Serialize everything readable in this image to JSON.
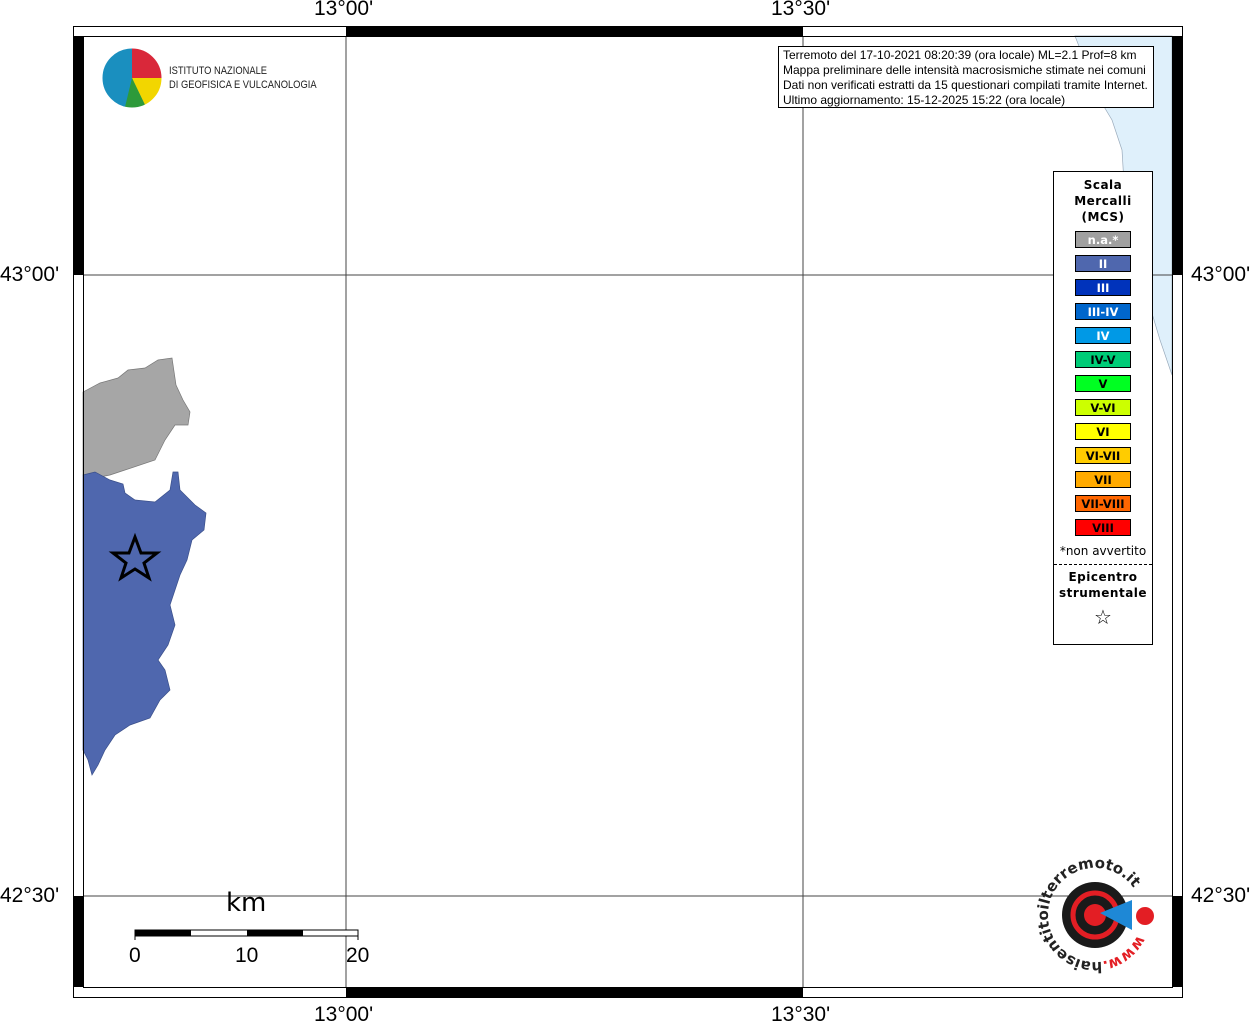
{
  "axes": {
    "lon_ticks": [
      "13°00'",
      "13°30'"
    ],
    "lat_ticks": [
      "43°00'",
      "42°30'"
    ]
  },
  "logo": {
    "line1": "ISTITUTO NAZIONALE",
    "line2": "DI GEOFISICA E VULCANOLOGIA"
  },
  "info": {
    "lines": [
      "Terremoto del 17-10-2021 08:20:39 (ora locale) ML=2.1 Prof=8 km",
      "Mappa preliminare delle intensità macrosismiche stimate nei comuni",
      "Dati non verificati estratti da 15 questionari compilati tramite Internet.",
      "Ultimo aggiornamento: 15-12-2025 15:22 (ora locale)"
    ]
  },
  "legend": {
    "title": [
      "Scala",
      "Mercalli",
      "(MCS)"
    ],
    "items": [
      {
        "label": "n.a.*",
        "color": "#a0a0a0",
        "text": "#fff"
      },
      {
        "label": "II",
        "color": "#4f67ae",
        "text": "#fff"
      },
      {
        "label": "III",
        "color": "#0033bb",
        "text": "#fff"
      },
      {
        "label": "III-IV",
        "color": "#0066cc",
        "text": "#fff"
      },
      {
        "label": "IV",
        "color": "#0099e6",
        "text": "#fff"
      },
      {
        "label": "IV-V",
        "color": "#00cc77",
        "text": "#000"
      },
      {
        "label": "V",
        "color": "#00ff22",
        "text": "#000"
      },
      {
        "label": "V-VI",
        "color": "#ccff00",
        "text": "#000"
      },
      {
        "label": "VI",
        "color": "#ffff00",
        "text": "#000"
      },
      {
        "label": "VI-VII",
        "color": "#ffcc00",
        "text": "#000"
      },
      {
        "label": "VII",
        "color": "#ffaa00",
        "text": "#000"
      },
      {
        "label": "VII-VIII",
        "color": "#ff6600",
        "text": "#000"
      },
      {
        "label": "VIII",
        "color": "#ff0000",
        "text": "#000"
      }
    ],
    "note": "*non avvertito",
    "epicenter": [
      "Epicentro",
      "strumentale"
    ],
    "epicenter_symbol": "☆"
  },
  "scale": {
    "unit": "km",
    "labels": [
      "0",
      "10",
      "20"
    ]
  },
  "brand": {
    "text": "haisentitoilterremoto.it",
    "www": "www."
  },
  "colors": {
    "sea": "#dff0fb",
    "intensity_II": "#4f67ae",
    "not_felt": "#a6a6a6"
  }
}
